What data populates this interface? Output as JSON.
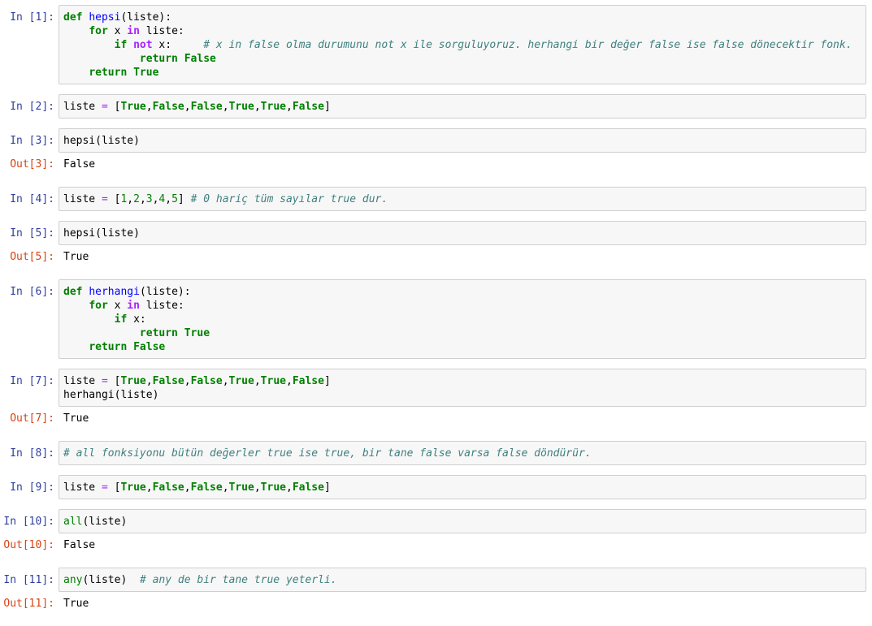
{
  "cells": [
    {
      "prompt": "In [1]:",
      "lines": [
        [
          {
            "t": "def",
            "c": "kw"
          },
          {
            "t": " "
          },
          {
            "t": "hepsi",
            "c": "fn"
          },
          {
            "t": "(liste):"
          }
        ],
        [
          {
            "t": "    "
          },
          {
            "t": "for",
            "c": "kw"
          },
          {
            "t": " x "
          },
          {
            "t": "in",
            "c": "op"
          },
          {
            "t": " liste:"
          }
        ],
        [
          {
            "t": "        "
          },
          {
            "t": "if",
            "c": "kw"
          },
          {
            "t": " "
          },
          {
            "t": "not",
            "c": "op"
          },
          {
            "t": " x:     "
          },
          {
            "t": "# x in false olma durumunu not x ile sorguluyoruz. herhangi bir değer false ise false dönecektir fonk.",
            "c": "cm"
          }
        ],
        [
          {
            "t": "            "
          },
          {
            "t": "return",
            "c": "kw"
          },
          {
            "t": " "
          },
          {
            "t": "False",
            "c": "kw"
          }
        ],
        [
          {
            "t": "    "
          },
          {
            "t": "return",
            "c": "kw"
          },
          {
            "t": " "
          },
          {
            "t": "True",
            "c": "kw"
          }
        ]
      ]
    },
    {
      "prompt": "In [2]:",
      "lines": [
        [
          {
            "t": "liste "
          },
          {
            "t": "=",
            "c": "op-plain"
          },
          {
            "t": " ["
          },
          {
            "t": "True",
            "c": "kw"
          },
          {
            "t": ","
          },
          {
            "t": "False",
            "c": "kw"
          },
          {
            "t": ","
          },
          {
            "t": "False",
            "c": "kw"
          },
          {
            "t": ","
          },
          {
            "t": "True",
            "c": "kw"
          },
          {
            "t": ","
          },
          {
            "t": "True",
            "c": "kw"
          },
          {
            "t": ","
          },
          {
            "t": "False",
            "c": "kw"
          },
          {
            "t": "]"
          }
        ]
      ]
    },
    {
      "prompt": "In [3]:",
      "lines": [
        [
          {
            "t": "hepsi(liste)"
          }
        ]
      ],
      "out_prompt": "Out[3]:",
      "output": "False"
    },
    {
      "prompt": "In [4]:",
      "lines": [
        [
          {
            "t": "liste "
          },
          {
            "t": "=",
            "c": "op-plain"
          },
          {
            "t": " ["
          },
          {
            "t": "1",
            "c": "num"
          },
          {
            "t": ","
          },
          {
            "t": "2",
            "c": "num"
          },
          {
            "t": ","
          },
          {
            "t": "3",
            "c": "num"
          },
          {
            "t": ","
          },
          {
            "t": "4",
            "c": "num"
          },
          {
            "t": ","
          },
          {
            "t": "5",
            "c": "num"
          },
          {
            "t": "] "
          },
          {
            "t": "# 0 hariç tüm sayılar true dur.",
            "c": "cm"
          }
        ]
      ]
    },
    {
      "prompt": "In [5]:",
      "lines": [
        [
          {
            "t": "hepsi(liste)"
          }
        ]
      ],
      "out_prompt": "Out[5]:",
      "output": "True"
    },
    {
      "prompt": "In [6]:",
      "lines": [
        [
          {
            "t": "def",
            "c": "kw"
          },
          {
            "t": " "
          },
          {
            "t": "herhangi",
            "c": "fn"
          },
          {
            "t": "(liste):"
          }
        ],
        [
          {
            "t": "    "
          },
          {
            "t": "for",
            "c": "kw"
          },
          {
            "t": " x "
          },
          {
            "t": "in",
            "c": "op"
          },
          {
            "t": " liste:"
          }
        ],
        [
          {
            "t": "        "
          },
          {
            "t": "if",
            "c": "kw"
          },
          {
            "t": " x:"
          }
        ],
        [
          {
            "t": "            "
          },
          {
            "t": "return",
            "c": "kw"
          },
          {
            "t": " "
          },
          {
            "t": "True",
            "c": "kw"
          }
        ],
        [
          {
            "t": "    "
          },
          {
            "t": "return",
            "c": "kw"
          },
          {
            "t": " "
          },
          {
            "t": "False",
            "c": "kw"
          }
        ]
      ]
    },
    {
      "prompt": "In [7]:",
      "lines": [
        [
          {
            "t": "liste "
          },
          {
            "t": "=",
            "c": "op-plain"
          },
          {
            "t": " ["
          },
          {
            "t": "True",
            "c": "kw"
          },
          {
            "t": ","
          },
          {
            "t": "False",
            "c": "kw"
          },
          {
            "t": ","
          },
          {
            "t": "False",
            "c": "kw"
          },
          {
            "t": ","
          },
          {
            "t": "True",
            "c": "kw"
          },
          {
            "t": ","
          },
          {
            "t": "True",
            "c": "kw"
          },
          {
            "t": ","
          },
          {
            "t": "False",
            "c": "kw"
          },
          {
            "t": "]"
          }
        ],
        [
          {
            "t": "herhangi(liste)"
          }
        ]
      ],
      "out_prompt": "Out[7]:",
      "output": "True"
    },
    {
      "prompt": "In [8]:",
      "lines": [
        [
          {
            "t": "# all fonksiyonu bütün değerler true ise true, bir tane false varsa false döndürür.",
            "c": "cm"
          }
        ]
      ]
    },
    {
      "prompt": "In [9]:",
      "lines": [
        [
          {
            "t": "liste "
          },
          {
            "t": "=",
            "c": "op-plain"
          },
          {
            "t": " ["
          },
          {
            "t": "True",
            "c": "kw"
          },
          {
            "t": ","
          },
          {
            "t": "False",
            "c": "kw"
          },
          {
            "t": ","
          },
          {
            "t": "False",
            "c": "kw"
          },
          {
            "t": ","
          },
          {
            "t": "True",
            "c": "kw"
          },
          {
            "t": ","
          },
          {
            "t": "True",
            "c": "kw"
          },
          {
            "t": ","
          },
          {
            "t": "False",
            "c": "kw"
          },
          {
            "t": "]"
          }
        ]
      ]
    },
    {
      "prompt": "In [10]:",
      "lines": [
        [
          {
            "t": "all",
            "c": "builtin"
          },
          {
            "t": "(liste)"
          }
        ]
      ],
      "out_prompt": "Out[10]:",
      "output": "False"
    },
    {
      "prompt": "In [11]:",
      "lines": [
        [
          {
            "t": "any",
            "c": "builtin"
          },
          {
            "t": "(liste)  "
          },
          {
            "t": "# any de bir tane true yeterli.",
            "c": "cm"
          }
        ]
      ],
      "out_prompt": "Out[11]:",
      "output": "True"
    }
  ]
}
